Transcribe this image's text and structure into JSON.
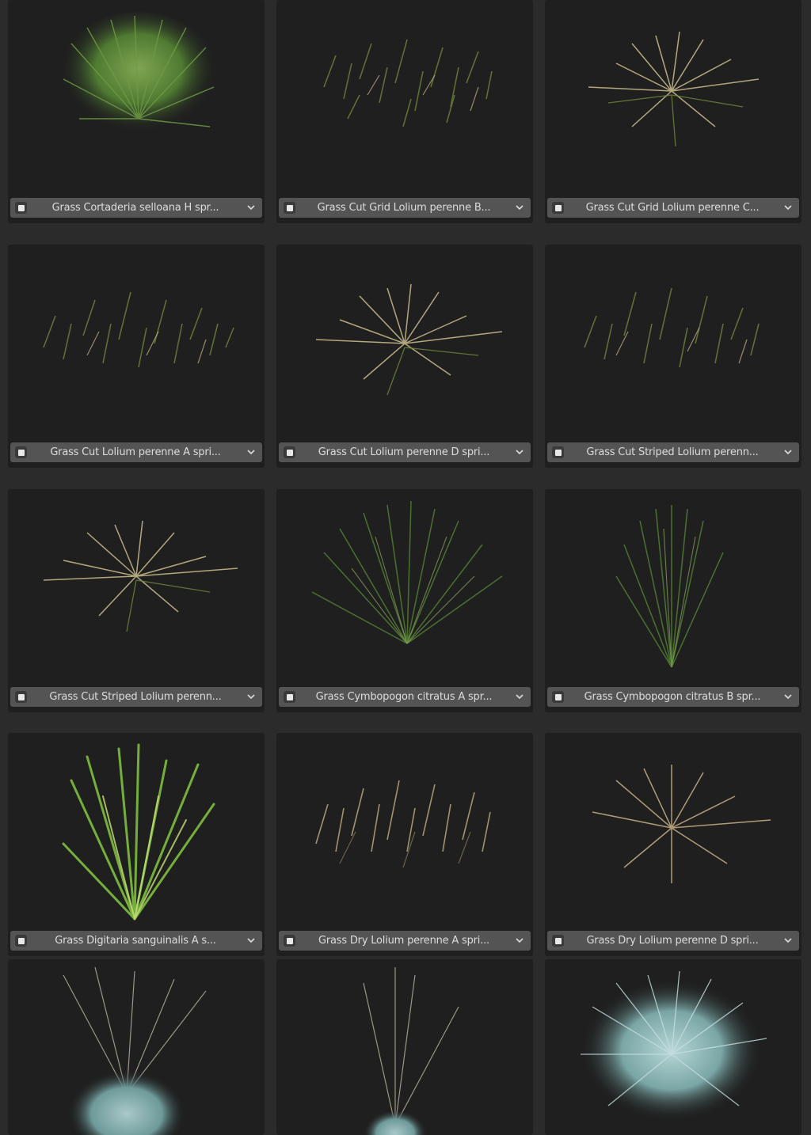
{
  "assets": [
    {
      "name": "Grass Cortaderia selloana H spr...",
      "thumb": "grass-dense-green"
    },
    {
      "name": "Grass Cut Grid Lolium perenne B...",
      "thumb": "grass-scatter-green"
    },
    {
      "name": "Grass Cut Grid Lolium perenne C...",
      "thumb": "grass-tuft-pale"
    },
    {
      "name": "Grass Cut Lolium perenne A spri...",
      "thumb": "grass-scatter-green"
    },
    {
      "name": "Grass Cut Lolium perenne D spri...",
      "thumb": "grass-tuft-pale"
    },
    {
      "name": "Grass Cut Striped Lolium perenn...",
      "thumb": "grass-scatter-green"
    },
    {
      "name": "Grass Cut Striped Lolium perenn...",
      "thumb": "grass-tuft-pale"
    },
    {
      "name": "Grass Cymbopogon citratus A spr...",
      "thumb": "grass-fan-green"
    },
    {
      "name": "Grass Cymbopogon citratus B spr...",
      "thumb": "grass-upright-green"
    },
    {
      "name": "Grass Digitaria sanguinalis A s...",
      "thumb": "grass-bright-stalks"
    },
    {
      "name": "Grass Dry Lolium perenne A spri...",
      "thumb": "grass-dry-scatter"
    },
    {
      "name": "Grass Dry Lolium perenne D spri...",
      "thumb": "grass-dry-tuft"
    },
    {
      "name": "",
      "thumb": "grass-blue-seedheads"
    },
    {
      "name": "",
      "thumb": "grass-blue-stalks"
    },
    {
      "name": "",
      "thumb": "grass-blue-tuft"
    }
  ],
  "icons": {
    "select": "checkbox-icon",
    "dropdown": "chevron-down-icon"
  },
  "colors": {
    "background": "#2b2b2b",
    "cell": "#1f1f1f",
    "label_bar": "#545454",
    "label_text": "#dcdcdc"
  }
}
